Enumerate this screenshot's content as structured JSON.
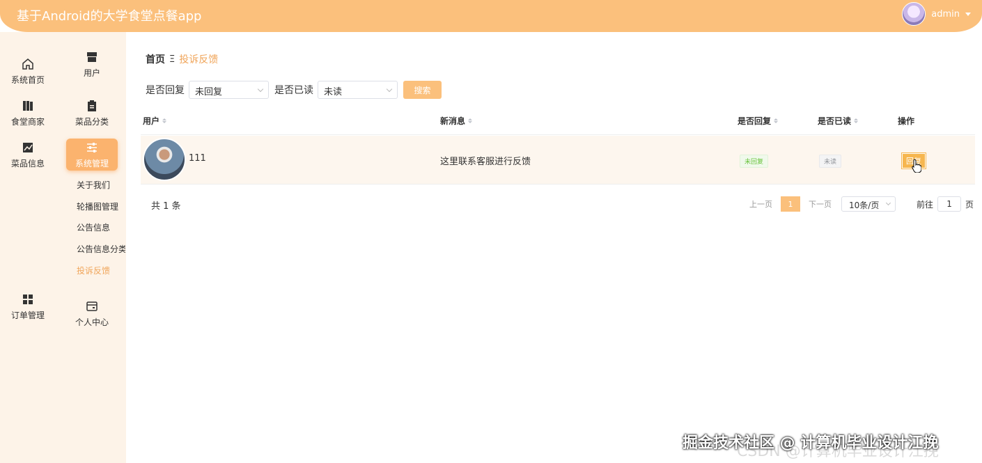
{
  "header": {
    "title": "基于Android的大学食堂点餐app",
    "user": "admin"
  },
  "sidebar": {
    "items": [
      {
        "label": "系统首页",
        "icon": "home-icon"
      },
      {
        "label": "用户",
        "icon": "store-icon"
      },
      {
        "label": "食堂商家",
        "icon": "book-icon"
      },
      {
        "label": "菜品分类",
        "icon": "clipboard-icon"
      },
      {
        "label": "菜品信息",
        "icon": "chart-icon"
      },
      {
        "label": "系统管理",
        "icon": "sliders-icon"
      },
      {
        "label": "订单管理",
        "icon": "grid-icon"
      },
      {
        "label": "个人中心",
        "icon": "wallet-icon"
      }
    ],
    "sub_items": [
      "关于我们",
      "轮播图管理",
      "公告信息",
      "公告信息分类",
      "投诉反馈"
    ]
  },
  "breadcrumb": {
    "home": "首页",
    "sep": "Ξ",
    "current": "投诉反馈"
  },
  "filter": {
    "reply_label": "是否回复",
    "reply_value": "未回复",
    "read_label": "是否已读",
    "read_value": "未读",
    "search_label": "搜索"
  },
  "table": {
    "headers": [
      "用户",
      "新消息",
      "是否回复",
      "是否已读",
      "操作"
    ],
    "rows": [
      {
        "user": "111",
        "message": "这里联系客服进行反馈",
        "replied": "未回复",
        "read": "未读",
        "action": "回复"
      }
    ]
  },
  "pagination": {
    "total": "共 1 条",
    "prev": "上一页",
    "current": "1",
    "next": "下一页",
    "page_size": "10条/页",
    "goto": "前往",
    "goto_value": "1",
    "page_unit": "页"
  },
  "watermark": "掘金技术社区 @ 计算机毕业设计江挽",
  "watermark_bg": "CSDN @计算机毕业设计江挽",
  "colors": {
    "accent": "#fbc07c",
    "active_text": "#f0a55a",
    "sidebar_bg": "#fdf3e8"
  }
}
